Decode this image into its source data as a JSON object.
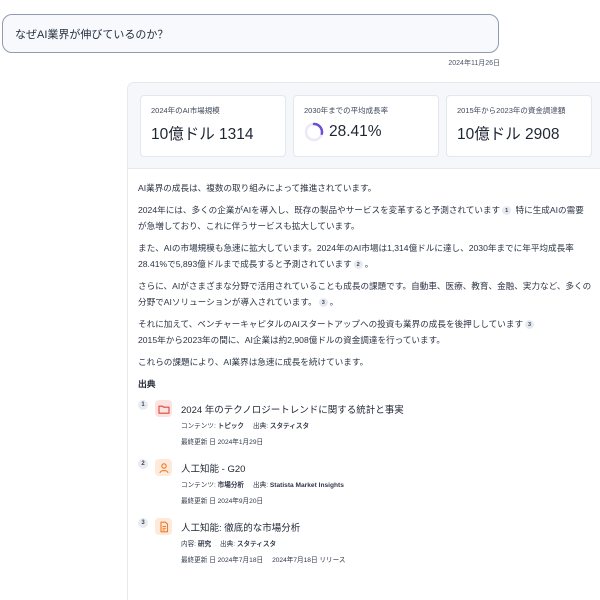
{
  "question": {
    "text": "なぜAI業界が伸びているのか？"
  },
  "date": "2024年11月26日",
  "stats": [
    {
      "label": "2024年のAI市場規模",
      "value": "10億ドル 1314"
    },
    {
      "label": "2030年までの平均成長率",
      "value": "28.41%",
      "progress": 0.2841
    },
    {
      "label": "2015年から2023年の資金調達額",
      "value": "10億ドル 2908"
    }
  ],
  "answer": {
    "p1": "AI業界の成長は、複数の取り組みによって推進されています。",
    "p2a": "2024年には、多くの企業がAIを導入し、既存の製品やサービスを変革すると予測されています",
    "p2b": " 特に生成AIの需要が急増しており、これに伴うサービスも拡大しています。",
    "p3": "また、AIの市場規模も急速に拡大しています。2024年のAI市場は1,314億ドルに達し、2030年までに年平均成長率28.41%で5,893億ドルまで成長すると予測されています",
    "p3end": "。",
    "p4": "さらに、AIがさまざまな分野で活用されていることも成長の課題です。自動車、医療、教育、金融、実力など、多くの分野でAIソリューションが導入されています。",
    "p4end": "。",
    "p5a": "それに加えて、ベンチャーキャピタルのAIスタートアップへの投資も業界の成長を後押ししています",
    "p5b": "2015年から2023年の間に、AI企業は約2,908億ドルの資金調達を行っています。",
    "p6": "これらの課題により、AI業界は急速に成長を続けています。",
    "citations": [
      "1",
      "2",
      "3",
      "3"
    ]
  },
  "sources": {
    "heading": "出典",
    "items": [
      {
        "num": "1",
        "title": "2024 年のテクノロジートレンドに関する統計と事実",
        "meta_label1": "コンテンツ: ",
        "meta_value1": "トピック",
        "meta_label2": "出典: ",
        "meta_value2": "スタティスタ",
        "updated": "最終更新 日 2024年1月29日",
        "icon": "folder-icon",
        "color": "#e0463a"
      },
      {
        "num": "2",
        "title": "人工知能 - G20",
        "meta_label1": "コンテンツ: ",
        "meta_value1": "市場分析",
        "meta_label2": "出典: ",
        "meta_value2": "Statista Market Insights",
        "updated": "最終更新 日 2024年9月20日",
        "icon": "person-icon",
        "color": "#ef7a2c"
      },
      {
        "num": "3",
        "title": "人工知能: 徹底的な市場分析",
        "meta_label1": "内容: ",
        "meta_value1": "研究",
        "meta_label2": "出典: ",
        "meta_value2": "スタティスタ",
        "updated": "最終更新 日 2024年7月18日",
        "release": "2024年7月18日 リリース",
        "icon": "document-icon",
        "color": "#ef7a2c"
      }
    ]
  }
}
